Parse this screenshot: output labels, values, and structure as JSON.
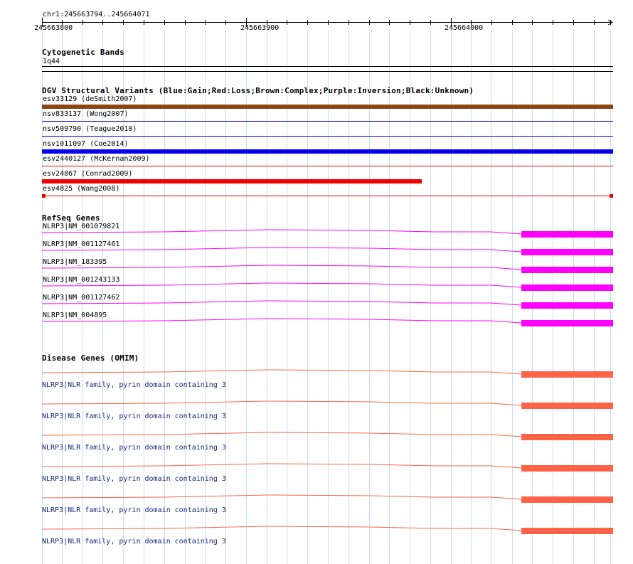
{
  "ruler": {
    "location": "chr1:245663794..245664071",
    "ticks": [
      "245663800",
      "245663900",
      "245664000"
    ]
  },
  "cytoband": {
    "title": "Cytogenetic Bands",
    "band": "1q44"
  },
  "dgv": {
    "title": "DGV Structural Variants (Blue:Gain;Red:Loss;Brown:Complex;Purple:Inversion;Black:Unknown)",
    "colors": {
      "gain": "#0000ee",
      "loss": "#ee0000",
      "complex": "#8b4513"
    },
    "variants": [
      {
        "label": "esv33129 (deSmith2007)",
        "type": "complex"
      },
      {
        "label": "nsv833137 (Wong2007)",
        "type": "gain"
      },
      {
        "label": "nsv509790 (Teague2010)",
        "type": "gain"
      },
      {
        "label": "nsv1011097 (Coe2014)",
        "type": "gain"
      },
      {
        "label": "esv2440127 (McKernan2009)",
        "type": "loss"
      },
      {
        "label": "esv24867 (Conrad2009)",
        "type": "loss"
      },
      {
        "label": "esv4825 (Wang2008)",
        "type": "loss"
      }
    ]
  },
  "refseq": {
    "title": "RefSeq Genes",
    "color": "#ff00ff",
    "genes": [
      "NLRP3|NM_001079821",
      "NLRP3|NM_001127461",
      "NLRP3|NM_183395",
      "NLRP3|NM_001243133",
      "NLRP3|NM_001127462",
      "NLRP3|NM_004895"
    ]
  },
  "omim": {
    "title": "Disease Genes (OMIM)",
    "color": "#ff6347",
    "genes": [
      "NLRP3|NLR family, pyrin domain containing 3",
      "NLRP3|NLR family, pyrin domain containing 3",
      "NLRP3|NLR family, pyrin domain containing 3",
      "NLRP3|NLR family, pyrin domain containing 3",
      "NLRP3|NLR family, pyrin domain containing 3",
      "NLRP3|NLR family, pyrin domain containing 3"
    ]
  }
}
